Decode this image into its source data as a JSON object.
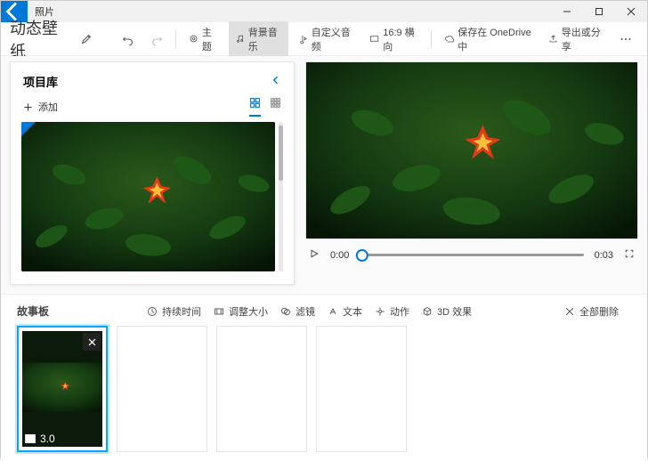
{
  "titlebar": {
    "app_name": "照片"
  },
  "toolbar": {
    "project_title": "动态壁纸",
    "theme": "主题",
    "bg_music": "背景音乐",
    "custom_audio": "自定义音频",
    "aspect": "16:9 横向",
    "save_cloud": "保存在 OneDrive 中",
    "export_share": "导出或分享"
  },
  "library": {
    "title": "项目库",
    "add": "添加"
  },
  "player": {
    "current": "0:00",
    "total": "0:03"
  },
  "storyboard": {
    "title": "故事板",
    "duration": "持续时间",
    "resize": "调整大小",
    "filter": "滤镜",
    "text": "文本",
    "motion": "动作",
    "fx3d": "3D 效果",
    "delete_all": "全部删除",
    "cards": [
      {
        "duration": "3.0"
      }
    ]
  }
}
